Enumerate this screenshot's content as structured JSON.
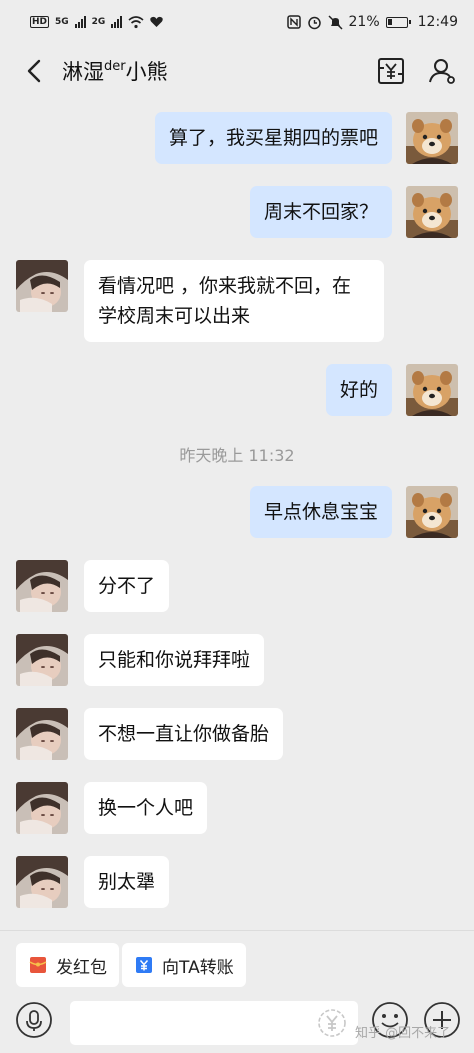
{
  "status_bar": {
    "hd": "HD",
    "net1": "5G",
    "net2": "2G",
    "battery_pct": "21%",
    "time": "12:49",
    "icons": [
      "nfc-icon",
      "alarm-icon",
      "mute-icon",
      "battery-icon",
      "wifi-icon",
      "heart-icon"
    ]
  },
  "header": {
    "title_main": "淋湿",
    "title_sup": "der",
    "title_end": "小熊",
    "icons": [
      "back-icon",
      "transfer-icon",
      "profile-icon"
    ]
  },
  "messages": [
    {
      "side": "right",
      "text": "算了，我买星期四的票吧",
      "avatar": "dog-avatar"
    },
    {
      "side": "right",
      "text": "周末不回家？",
      "avatar": "dog-avatar"
    },
    {
      "side": "left",
      "text": "看情况吧 ，你来我就不回，在学校周末可以出来",
      "avatar": "girl-avatar"
    },
    {
      "side": "right",
      "text": "好的",
      "avatar": "dog-avatar"
    },
    {
      "side": "right",
      "text": "早点休息宝宝",
      "avatar": "dog-avatar"
    },
    {
      "side": "left",
      "text": "分不了",
      "avatar": "girl-avatar"
    },
    {
      "side": "left",
      "text": "只能和你说拜拜啦",
      "avatar": "girl-avatar"
    },
    {
      "side": "left",
      "text": "不想一直让你做备胎",
      "avatar": "girl-avatar"
    },
    {
      "side": "left",
      "text": "换一个人吧",
      "avatar": "girl-avatar"
    },
    {
      "side": "left",
      "text": "别太犟",
      "avatar": "girl-avatar"
    }
  ],
  "time_divider": "昨天晚上 11:32",
  "quick_actions": {
    "red_packet": "发红包",
    "transfer": "向TA转账"
  },
  "input_bar": {
    "placeholder": "",
    "icons": [
      "voice-icon",
      "yuan-icon",
      "emoji-icon",
      "plus-icon"
    ]
  },
  "watermark": "知乎 @回不来了",
  "colors": {
    "background": "#ededed",
    "my_bubble": "#d4e6ff",
    "their_bubble": "#ffffff",
    "red_packet": "#e8553b",
    "transfer_blue": "#2f7bf5"
  }
}
